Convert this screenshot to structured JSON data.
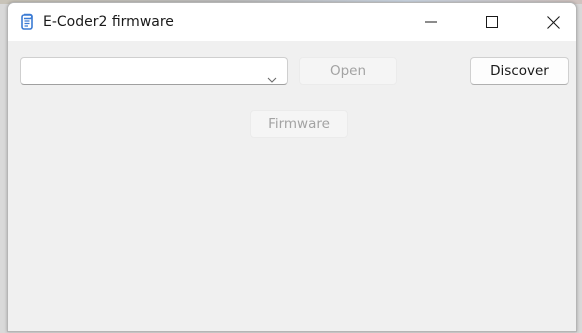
{
  "window": {
    "title": "E-Coder2 firmware",
    "app_icon": "scroll-file-icon",
    "controls": [
      "minimize-icon",
      "maximize-icon",
      "close-icon"
    ]
  },
  "toolbar": {
    "device_select": {
      "value": "",
      "chevron_icon": "chevron-down-icon"
    },
    "open_label": "Open",
    "open_enabled": false,
    "discover_label": "Discover",
    "discover_enabled": true
  },
  "main": {
    "firmware_label": "Firmware",
    "firmware_enabled": false
  },
  "colors": {
    "titlebar_bg": "#ffffff",
    "client_bg": "#f0f0f0",
    "disabled_text": "#a3a3a3",
    "text": "#1a1a1a",
    "icon_accent": "#3b7bd4"
  }
}
